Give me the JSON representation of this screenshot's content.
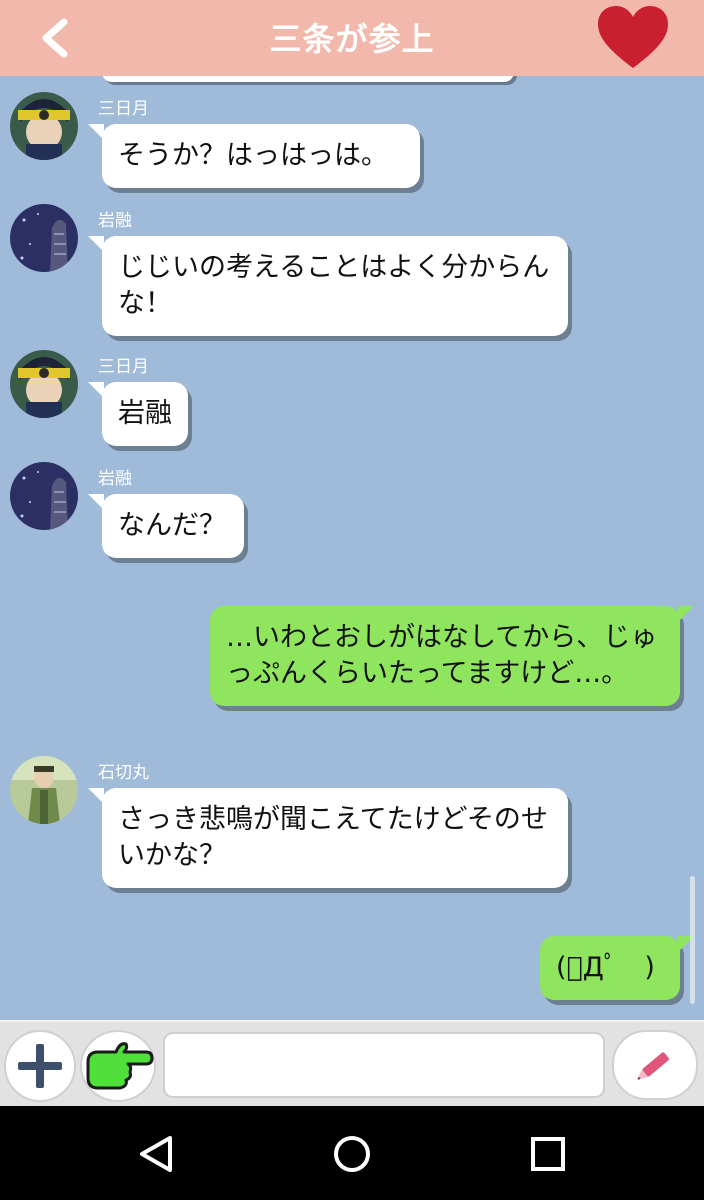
{
  "header": {
    "title": "三条が参上",
    "back_icon": "chevron-left-icon",
    "heart_icon": "heart-icon",
    "bg_color": "#f1b8ab",
    "heart_color": "#c8202e"
  },
  "chat": {
    "bg_color": "#9fbbd9",
    "messages": [
      {
        "sender": "三日月",
        "text": "そうか？はっはっは。",
        "side": "in"
      },
      {
        "sender": "岩融",
        "text": "じじいの考えることはよく分からんな！",
        "side": "in"
      },
      {
        "sender": "三日月",
        "text": "岩融",
        "side": "in"
      },
      {
        "sender": "岩融",
        "text": "なんだ？",
        "side": "in"
      },
      {
        "text": "…いわとおしがはなしてから、じゅっぷんくらいたってますけど…。",
        "side": "out"
      },
      {
        "sender": "石切丸",
        "text": "さっき悲鳴が聞こえてたけどそのせいかな？",
        "side": "in"
      },
      {
        "text": "(ﾟДﾟ　)",
        "side": "out"
      }
    ]
  },
  "input_bar": {
    "plus_icon": "plus-icon",
    "stamp_icon": "pointing-hand-icon",
    "pencil_icon": "pencil-icon",
    "input_value": "",
    "input_placeholder": ""
  },
  "nav": {
    "back_icon": "triangle-back-icon",
    "home_icon": "circle-home-icon",
    "recent_icon": "square-recent-icon"
  },
  "colors": {
    "incoming_bubble": "#ffffff",
    "outgoing_bubble": "#8fe55e"
  }
}
